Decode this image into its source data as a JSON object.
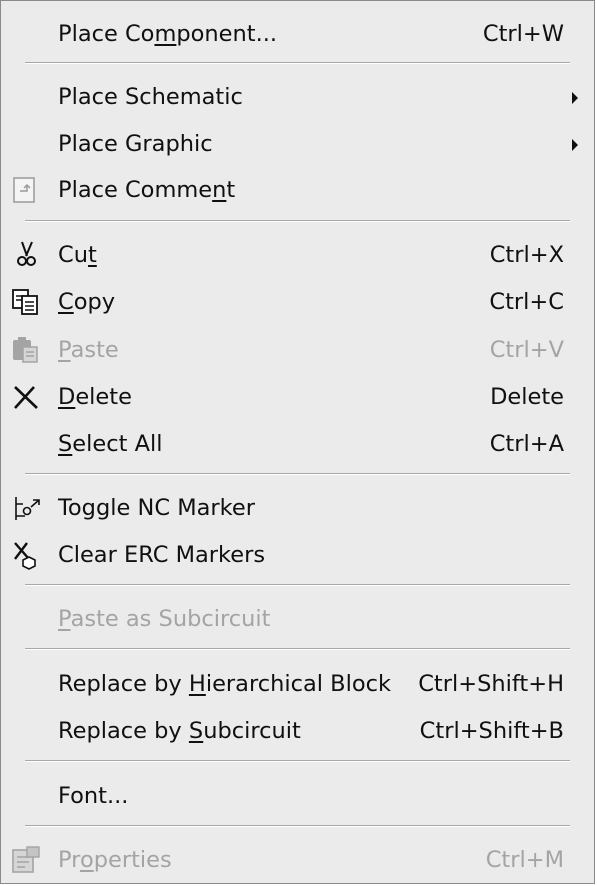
{
  "menu": {
    "items": [
      {
        "label_pre": "Place Co",
        "label_u": "m",
        "label_post": "ponent...",
        "shortcut": "Ctrl+W"
      },
      {
        "label_pre": "Place Schematic",
        "label_u": "",
        "label_post": "",
        "shortcut": ""
      },
      {
        "label_pre": "Place Graphic",
        "label_u": "",
        "label_post": "",
        "shortcut": ""
      },
      {
        "label_pre": "Place Comme",
        "label_u": "n",
        "label_post": "t",
        "shortcut": "",
        "icon": "comment-icon"
      },
      {
        "label_pre": "Cu",
        "label_u": "t",
        "label_post": "",
        "shortcut": "Ctrl+X",
        "icon": "scissors-icon"
      },
      {
        "label_pre": "",
        "label_u": "C",
        "label_post": "opy",
        "shortcut": "Ctrl+C",
        "icon": "copy-icon"
      },
      {
        "label_pre": "",
        "label_u": "P",
        "label_post": "aste",
        "shortcut": "Ctrl+V",
        "icon": "clipboard-icon",
        "disabled": true
      },
      {
        "label_pre": "",
        "label_u": "D",
        "label_post": "elete",
        "shortcut": "Delete",
        "icon": "delete-x-icon"
      },
      {
        "label_pre": "",
        "label_u": "S",
        "label_post": "elect All",
        "shortcut": "Ctrl+A"
      },
      {
        "label_pre": "Toggle NC Marker",
        "label_u": "",
        "label_post": "",
        "shortcut": "",
        "icon": "nc-marker-icon"
      },
      {
        "label_pre": "Clear ERC Markers",
        "label_u": "",
        "label_post": "",
        "shortcut": "",
        "icon": "clear-erc-icon"
      },
      {
        "label_pre": "",
        "label_u": "P",
        "label_post": "aste as Subcircuit",
        "shortcut": "",
        "disabled": true
      },
      {
        "label_pre": "Replace by ",
        "label_u": "H",
        "label_post": "ierarchical Block",
        "shortcut": "Ctrl+Shift+H"
      },
      {
        "label_pre": "Replace by ",
        "label_u": "S",
        "label_post": "ubcircuit",
        "shortcut": "Ctrl+Shift+B"
      },
      {
        "label_pre": "Font...",
        "label_u": "",
        "label_post": "",
        "shortcut": ""
      },
      {
        "label_pre": "Pr",
        "label_u": "o",
        "label_post": "perties",
        "shortcut": "Ctrl+M",
        "icon": "properties-icon",
        "disabled": true
      }
    ],
    "submenu_indicator": "right-triangle-icon",
    "colors": {
      "background": "#ebebeb",
      "text": "#101010",
      "disabled_text": "#a4a4a4",
      "separator": "#a8a8a8"
    }
  }
}
